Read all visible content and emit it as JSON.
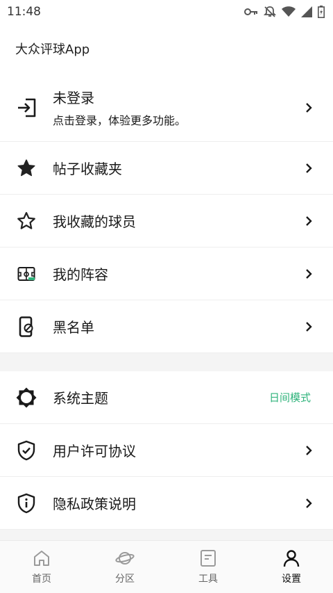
{
  "status_bar": {
    "time": "11:48"
  },
  "app": {
    "title": "大众评球App"
  },
  "login": {
    "title": "未登录",
    "subtitle": "点击登录，体验更多功能。"
  },
  "menu_items": [
    {
      "label": "帖子收藏夹"
    },
    {
      "label": "我收藏的球员"
    },
    {
      "label": "我的阵容"
    },
    {
      "label": "黑名单"
    }
  ],
  "settings_items": [
    {
      "label": "系统主题",
      "value": "日间模式"
    },
    {
      "label": "用户许可协议"
    },
    {
      "label": "隐私政策说明"
    }
  ],
  "colors": {
    "accent": "#2fb37b",
    "icon": "#1a1a1a",
    "nav_inactive": "#9a9a9a"
  },
  "bottom_nav": [
    {
      "label": "首页",
      "icon": "home-icon"
    },
    {
      "label": "分区",
      "icon": "planet-icon"
    },
    {
      "label": "工具",
      "icon": "note-icon"
    },
    {
      "label": "设置",
      "icon": "person-icon",
      "active": true
    }
  ]
}
